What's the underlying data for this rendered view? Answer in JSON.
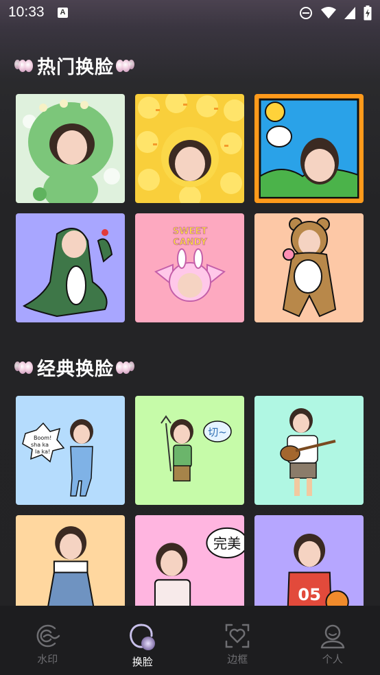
{
  "status_bar": {
    "time": "10:33",
    "notification_icon": "a-icon",
    "notification_letter": "A",
    "icons": [
      "do-not-disturb-icon",
      "wifi-icon",
      "signal-icon",
      "battery-icon"
    ]
  },
  "sections": [
    {
      "title": "热门换脸",
      "items": [
        {
          "name": "green-dino-hood-template",
          "bg": "#dff1dd"
        },
        {
          "name": "yellow-ducks-template",
          "bg": "#f9cf3b"
        },
        {
          "name": "cartoon-frame-template",
          "bg": "#ff9a1b"
        },
        {
          "name": "green-dinosaur-costume-template",
          "bg": "#a8a6ff"
        },
        {
          "name": "sweet-candy-template",
          "bg": "#fda9c0",
          "text": "SWEET CANDY"
        },
        {
          "name": "bear-costume-template",
          "bg": "#fdc8a6"
        }
      ]
    },
    {
      "title": "经典换脸",
      "items": [
        {
          "name": "boom-overalls-template",
          "bg": "#b5dcfd",
          "text": "Boom! sha ka la ka!"
        },
        {
          "name": "devil-pitchfork-template",
          "bg": "#c6fba9",
          "text": "切~"
        },
        {
          "name": "ukulele-template",
          "bg": "#b0f7e3"
        },
        {
          "name": "denim-overalls-template",
          "bg": "#ffd79f"
        },
        {
          "name": "perfect-sign-template",
          "bg": "#ffb5e0",
          "text": "完美"
        },
        {
          "name": "basketball-jersey-template",
          "bg": "#b6a6ff",
          "text": "05"
        }
      ]
    }
  ],
  "bottom_nav": [
    {
      "label": "水印",
      "icon": "watermark-icon",
      "active": false
    },
    {
      "label": "换脸",
      "icon": "face-swap-icon",
      "active": true
    },
    {
      "label": "边框",
      "icon": "frame-heart-icon",
      "active": false
    },
    {
      "label": "个人",
      "icon": "person-icon",
      "active": false
    }
  ],
  "colors": {
    "background": "#232325",
    "navbar": "#1d1d1f",
    "nav_inactive": "#6e6e72",
    "nav_active": "#ffffff"
  }
}
